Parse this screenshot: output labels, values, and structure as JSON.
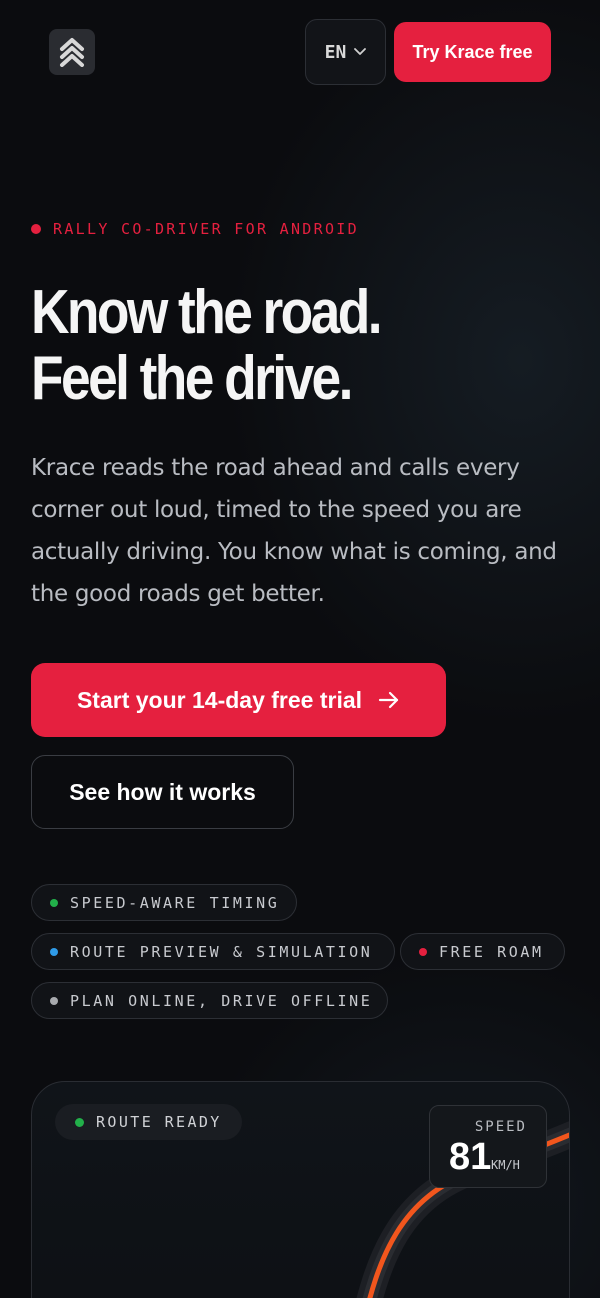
{
  "header": {
    "logo_icon": "double-chevron-up-icon",
    "language": "EN",
    "language_icon": "chevron-down-icon",
    "cta_label": "Try Krace free"
  },
  "hero": {
    "eyebrow": "RALLY CO-DRIVER FOR ANDROID",
    "headline_line1": "Know the road.",
    "headline_line2": "Feel the drive.",
    "lead": "Krace reads the road ahead and calls every corner out loud, timed to the speed you are actually driving. You know what is coming, and the good roads get better.",
    "primary_cta": "Start your 14-day free trial",
    "primary_cta_icon": "arrow-right-icon",
    "secondary_cta": "See how it works"
  },
  "features": [
    {
      "label": "SPEED-AWARE TIMING",
      "color": "#22b04a"
    },
    {
      "label": "ROUTE PREVIEW & SIMULATION",
      "color": "#2f9be8"
    },
    {
      "label": "FREE ROAM",
      "color": "#e5203f"
    },
    {
      "label": "PLAN ONLINE, DRIVE OFFLINE",
      "color": "#a8aaae"
    }
  ],
  "preview": {
    "status": "ROUTE READY",
    "status_color": "#22b04a",
    "speed_label": "SPEED",
    "speed_value": "81",
    "speed_unit": "KM/H",
    "route_color": "#f2561d"
  },
  "colors": {
    "accent": "#e5203f",
    "background": "#0b0c0f"
  }
}
